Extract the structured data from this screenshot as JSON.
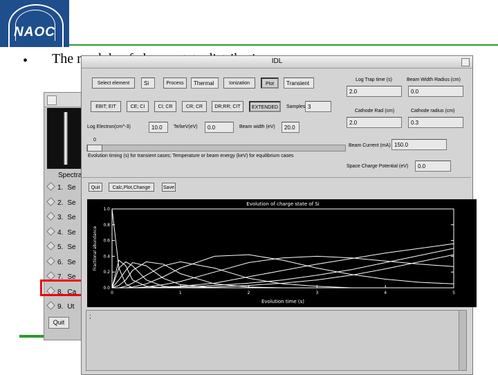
{
  "slide": {
    "logo_text": "NAOC",
    "bullet": "•",
    "text": "The module of charge state distribution"
  },
  "back_window": {
    "title": "Spectral",
    "items": [
      {
        "num": "1.",
        "label": "Se"
      },
      {
        "num": "2.",
        "label": "Se"
      },
      {
        "num": "3.",
        "label": "Se"
      },
      {
        "num": "4.",
        "label": "Se"
      },
      {
        "num": "5.",
        "label": "Se"
      },
      {
        "num": "6.",
        "label": "Se"
      },
      {
        "num": "7.",
        "label": "Se"
      },
      {
        "num": "8.",
        "label": "Ca"
      },
      {
        "num": "9.",
        "label": "Ut"
      }
    ],
    "quit_label": "Quit"
  },
  "front_window": {
    "title": "IDL",
    "row1": {
      "select_element": "Select element",
      "element_value": "Si",
      "process_btn": "Process",
      "process_value": "Thermal",
      "ionization_btn": "Ionization",
      "mode_btn": "Plot",
      "mode_value": "Transient"
    },
    "row2": {
      "buttons": [
        "EBIT; EIT",
        "CE; CI",
        "CI; CR",
        "CR; CR",
        "DR;RR; CIT",
        "EXTENDED"
      ],
      "samples_label": "Samples",
      "samples_value": "3"
    },
    "row3": {
      "log_density_label": "Log Electron(cm^-3)",
      "log_density_value": "10.0",
      "te_label": "Te/keV(eV)",
      "te_value": "0.0",
      "beam_label": "Beam width (eV)",
      "beam_value": "20.0"
    },
    "slider": {
      "label": "0",
      "description": "Evolution timing (s) for transient cases; Temperature or beam energy (keV) for equilibrium cases"
    },
    "right_panel": {
      "log_trap_label": "Log Trap time (s)",
      "log_trap_value": "2.0",
      "beam_radius_label": "Beam Width Radius (cm)",
      "beam_radius_value": "0.0",
      "cathode_label": "Cathode Rad (cm)",
      "cathode_value": "2.0",
      "cathode_radius_label": "Cathode radius (cm)",
      "cathode_radius_value": "0.3",
      "beam_current_label": "Beam Current (mA)",
      "beam_current_value": "150.0",
      "space_charge_label": "Space Charge Potential (eV)",
      "space_charge_value": "0.0"
    },
    "toolbar": {
      "quit": "Quit",
      "plot_btn": "Calc,Plot,Change",
      "save": "Save"
    },
    "console_prompt": ";"
  },
  "chart_data": {
    "type": "line",
    "title": "Evolution of charge state of Si",
    "xlabel": "Evolution time (s)",
    "ylabel": "Fractional abundance",
    "xlim": [
      0,
      5
    ],
    "ylim": [
      0,
      1
    ],
    "xticks": [
      "0",
      "1",
      "2",
      "3",
      "4",
      "5"
    ],
    "yticks": [
      "0.0",
      "0.2",
      "0.4",
      "0.6",
      "0.8",
      "1.0"
    ],
    "x": [
      0,
      0.1,
      0.2,
      0.3,
      0.5,
      0.75,
      1,
      1.5,
      2,
      2.5,
      3,
      3.5,
      4,
      4.5,
      5
    ],
    "series": [
      {
        "values": [
          1.0,
          0.25,
          0.05,
          0.0,
          0.0,
          0,
          0,
          0,
          0,
          0,
          0,
          0,
          0,
          0,
          0
        ]
      },
      {
        "values": [
          0.0,
          0.35,
          0.28,
          0.1,
          0.02,
          0,
          0,
          0,
          0,
          0,
          0,
          0,
          0,
          0,
          0
        ]
      },
      {
        "values": [
          0.0,
          0.25,
          0.33,
          0.28,
          0.1,
          0.02,
          0,
          0,
          0,
          0,
          0,
          0,
          0,
          0,
          0
        ]
      },
      {
        "values": [
          0.0,
          0.1,
          0.22,
          0.32,
          0.28,
          0.12,
          0.04,
          0,
          0,
          0,
          0,
          0,
          0,
          0,
          0
        ]
      },
      {
        "values": [
          0.0,
          0.03,
          0.1,
          0.22,
          0.33,
          0.3,
          0.18,
          0.05,
          0.01,
          0,
          0,
          0,
          0,
          0,
          0
        ]
      },
      {
        "values": [
          0.0,
          0.0,
          0.02,
          0.06,
          0.16,
          0.28,
          0.33,
          0.25,
          0.12,
          0.05,
          0.02,
          0,
          0,
          0,
          0
        ]
      },
      {
        "values": [
          0.0,
          0.0,
          0.0,
          0.01,
          0.05,
          0.14,
          0.25,
          0.4,
          0.42,
          0.35,
          0.25,
          0.17,
          0.11,
          0.07,
          0.05
        ]
      },
      {
        "values": [
          0.0,
          0.0,
          0.0,
          0.0,
          0.01,
          0.04,
          0.08,
          0.2,
          0.32,
          0.38,
          0.4,
          0.38,
          0.34,
          0.3,
          0.27
        ]
      },
      {
        "values": [
          0.0,
          0.0,
          0.0,
          0.0,
          0.0,
          0.01,
          0.02,
          0.06,
          0.14,
          0.22,
          0.3,
          0.37,
          0.44,
          0.5,
          0.56
        ]
      },
      {
        "values": [
          0.0,
          0.0,
          0.0,
          0.0,
          0.0,
          0.0,
          0.01,
          0.03,
          0.06,
          0.1,
          0.16,
          0.23,
          0.32,
          0.41,
          0.5
        ]
      },
      {
        "values": [
          0.0,
          0.0,
          0.0,
          0.0,
          0.0,
          0.0,
          0.0,
          0.01,
          0.03,
          0.06,
          0.1,
          0.16,
          0.24,
          0.33,
          0.42
        ]
      }
    ],
    "line_color": "#ffffff",
    "background": "#000000"
  }
}
